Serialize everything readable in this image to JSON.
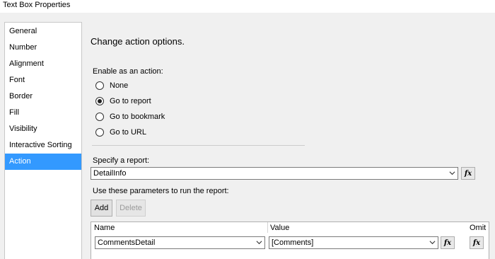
{
  "window": {
    "title": "Text Box Properties"
  },
  "sidebar": {
    "items": [
      {
        "label": "General"
      },
      {
        "label": "Number"
      },
      {
        "label": "Alignment"
      },
      {
        "label": "Font"
      },
      {
        "label": "Border"
      },
      {
        "label": "Fill"
      },
      {
        "label": "Visibility"
      },
      {
        "label": "Interactive Sorting"
      },
      {
        "label": "Action"
      }
    ],
    "selected": "Action"
  },
  "main": {
    "heading": "Change action options.",
    "enable_label": "Enable as an action:",
    "options": [
      {
        "label": "None",
        "checked": false
      },
      {
        "label": "Go to report",
        "checked": true
      },
      {
        "label": "Go to bookmark",
        "checked": false
      },
      {
        "label": "Go to URL",
        "checked": false
      }
    ],
    "report_label": "Specify a report:",
    "report_value": "DetailInfo",
    "fx_symbol": "fx",
    "params_label": "Use these parameters to run the report:",
    "add_label": "Add",
    "delete_label": "Delete",
    "grid": {
      "headers": {
        "name": "Name",
        "value": "Value",
        "omit": "Omit"
      },
      "rows": [
        {
          "name": "CommentsDetail",
          "value": "[Comments]"
        }
      ]
    }
  },
  "colors": {
    "selection": "#3399ff",
    "dialog_bg": "#f0f0f0"
  }
}
